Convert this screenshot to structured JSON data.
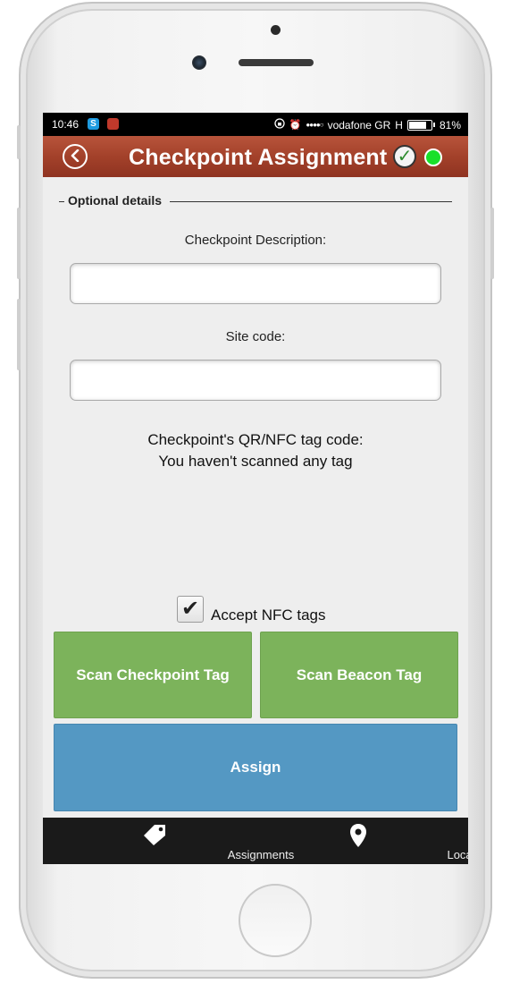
{
  "status_bar": {
    "time": "10:46",
    "skype_badge": "S",
    "carrier": "vodafone GR",
    "network": "H",
    "battery_percent": "81%",
    "battery_level": 0.81,
    "alarm_glyph": "⏰",
    "signal_glyph": "●●●●○"
  },
  "app_bar": {
    "back_glyph": "<",
    "title": "Checkpoint Assignment",
    "sync_glyph": "✓",
    "online_color": "#18e02a"
  },
  "form": {
    "section_title": "Optional details",
    "description_label": "Checkpoint Description:",
    "description_value": "",
    "site_code_label": "Site code:",
    "site_code_value": "",
    "tag_code_label": "Checkpoint's QR/NFC tag code:",
    "tag_code_status": "You haven't scanned any tag",
    "accept_nfc_label": "Accept NFC tags",
    "accept_nfc_checked": true,
    "check_glyph": "✔"
  },
  "actions": {
    "scan_checkpoint": "Scan Checkpoint Tag",
    "scan_beacon": "Scan Beacon Tag",
    "assign": "Assign"
  },
  "bottom_nav": {
    "assignments_label": "Assignments",
    "assignments_icon": "tag-icon",
    "locate_label": "Locate",
    "locate_icon": "map-pin-icon"
  },
  "colors": {
    "app_bar": "#a3412a",
    "green_button": "#7cb35b",
    "blue_button": "#5498c3",
    "bottom_nav": "#1a1a1a"
  }
}
